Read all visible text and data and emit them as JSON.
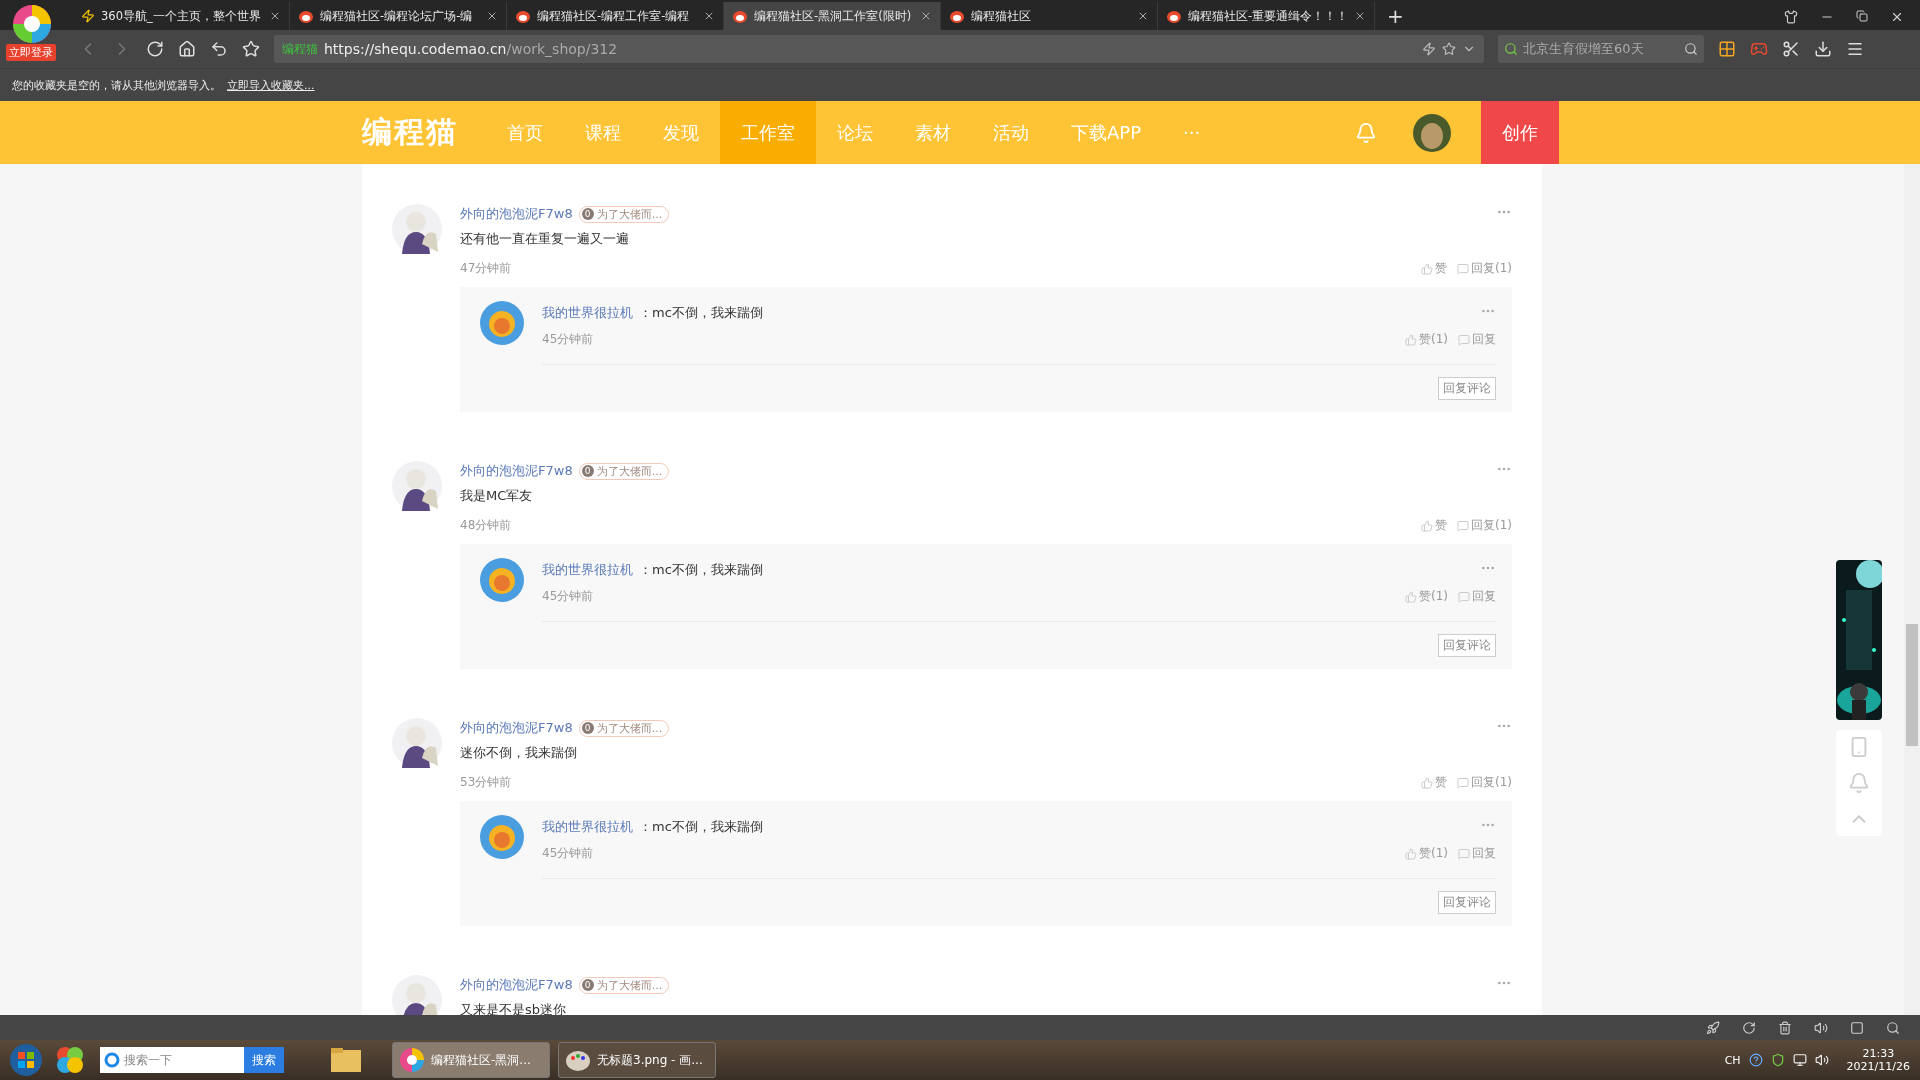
{
  "browser": {
    "login_badge": "立即登录",
    "tabs": [
      {
        "title": "360导航_一个主页，整个世界",
        "selected": false
      },
      {
        "title": "编程猫社区-编程论坛广场-编",
        "selected": false
      },
      {
        "title": "编程猫社区-编程工作室-编程",
        "selected": false
      },
      {
        "title": "编程猫社区-黑洞工作室(限时)",
        "selected": true
      },
      {
        "title": "编程猫社区",
        "selected": false
      },
      {
        "title": "编程猫社区-重要通缉令！！！",
        "selected": false
      }
    ],
    "new_tab": "+",
    "site_label": "编程猫",
    "url_host": "https://shequ.codemao.cn",
    "url_path": "/work_shop/312",
    "search_placeholder": "北京生育假增至60天",
    "bookmarks_message": "您的收藏夹是空的，请从其他浏览器导入。",
    "bookmarks_link": "立即导入收藏夹..."
  },
  "nav": {
    "logo": "编程猫",
    "items": [
      {
        "label": "首页",
        "selected": false
      },
      {
        "label": "课程",
        "selected": false
      },
      {
        "label": "发现",
        "selected": false
      },
      {
        "label": "工作室",
        "selected": true
      },
      {
        "label": "论坛",
        "selected": false
      },
      {
        "label": "素材",
        "selected": false
      },
      {
        "label": "活动",
        "selected": false
      },
      {
        "label": "下载APP",
        "selected": false
      }
    ],
    "more": "···",
    "create": "创作"
  },
  "comments": [
    {
      "author": "外向的泡泡泥F7w8",
      "badge_count": "0",
      "badge": "为了大佬而...",
      "text": "还有他一直在重复一遍又一遍",
      "time": "47分钟前",
      "like": "赞",
      "reply": "回复(1)",
      "replies": [
        {
          "author": "我的世界很拉机",
          "text": "：mc不倒，我来踹倒",
          "time": "45分钟前",
          "like": "赞(1)",
          "reply": "回复"
        }
      ],
      "reply_button": "回复评论"
    },
    {
      "author": "外向的泡泡泥F7w8",
      "badge_count": "0",
      "badge": "为了大佬而...",
      "text": "我是MC军友",
      "time": "48分钟前",
      "like": "赞",
      "reply": "回复(1)",
      "replies": [
        {
          "author": "我的世界很拉机",
          "text": "：mc不倒，我来踹倒",
          "time": "45分钟前",
          "like": "赞(1)",
          "reply": "回复"
        }
      ],
      "reply_button": "回复评论"
    },
    {
      "author": "外向的泡泡泥F7w8",
      "badge_count": "0",
      "badge": "为了大佬而...",
      "text": "迷你不倒，我来踹倒",
      "time": "53分钟前",
      "like": "赞",
      "reply": "回复(1)",
      "replies": [
        {
          "author": "我的世界很拉机",
          "text": "：mc不倒，我来踹倒",
          "time": "45分钟前",
          "like": "赞(1)",
          "reply": "回复"
        }
      ],
      "reply_button": "回复评论"
    },
    {
      "author": "外向的泡泡泥F7w8",
      "badge_count": "0",
      "badge": "为了大佬而...",
      "text": "又来是不是sb迷你"
    }
  ],
  "taskbar": {
    "search_placeholder": "搜索一下",
    "search_button": "搜索",
    "tasks": [
      {
        "title": "编程猫社区-黑洞...",
        "selected": true
      },
      {
        "title": "无标题3.png - 画...",
        "selected": false
      }
    ],
    "ime": "CH",
    "time": "21:33",
    "date": "2021/11/26"
  }
}
